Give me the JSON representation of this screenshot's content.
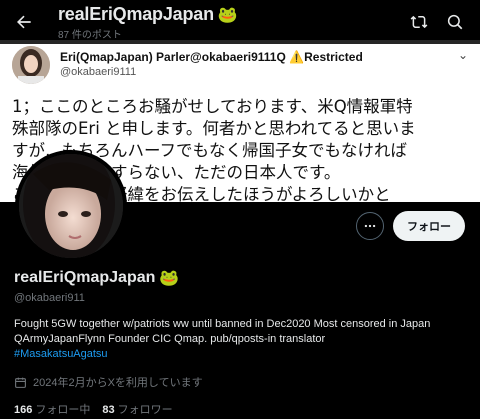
{
  "header": {
    "title": "realEriQmapJapan",
    "title_emoji": "🐸",
    "post_count": "87 件のポスト"
  },
  "banner_tweet": {
    "author_name": "Eri(QmapJapan) Parler@okabaeri9111Q",
    "restricted_label": "⚠️Restricted",
    "author_handle": "@okabaeri9111",
    "lines": [
      "1；ここのところお騒がせしております、米Q情報軍特",
      "殊部隊のEri と申します。何者かと思われてると思いま",
      "すが…もちろんハーフでもなく帰国子女でもなければ",
      "海外留学経験すらない、ただの日本人です。",
      "ここに至った経緯をお伝えしたほうがよろしいかと"
    ]
  },
  "actions": {
    "follow_label": "フォロー"
  },
  "profile": {
    "name": "realEriQmapJapan",
    "name_emoji": "🐸",
    "handle": "@okabaeri911",
    "bio": "Fought 5GW together w/patriots ww until banned in Dec2020 Most censored in Japan QArmyJapanFlynn Founder CIC Qmap. pub/qposts-in translator",
    "hashtag": "#MasakatsuAgatsu",
    "joined": "2024年2月からXを利用しています",
    "following_count": "166",
    "following_label": "フォロー中",
    "followers_count": "83",
    "followers_label": "フォロワー"
  },
  "colors": {
    "background": "#000000",
    "text": "#e7e9ea",
    "muted": "#71767b",
    "link": "#1d9bf0"
  }
}
